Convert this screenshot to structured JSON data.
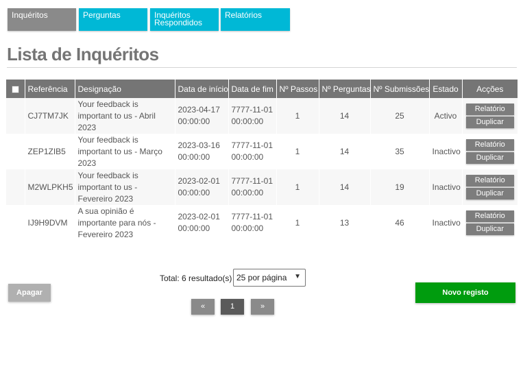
{
  "tabs": [
    {
      "label": "Inquéritos",
      "active": true
    },
    {
      "label": "Perguntas",
      "active": false
    },
    {
      "label": "Inquéritos Respondidos",
      "active": false
    },
    {
      "label": "Relatórios",
      "active": false
    }
  ],
  "page_title": "Lista de Inquéritos",
  "table": {
    "headers": [
      "Referência",
      "Designação",
      "Data de início",
      "Data de fim",
      "Nº Passos",
      "Nº Perguntas",
      "Nº Submissões",
      "Estado",
      "Acções"
    ],
    "rows": [
      {
        "ref": "CJ7TM7JK",
        "desig": "Your feedback is important to us - Abril 2023",
        "start": "2023-04-17 00:00:00",
        "end": "7777-11-01 00:00:00",
        "steps": "1",
        "questions": "14",
        "submissions": "25",
        "status": "Activo",
        "active": true
      },
      {
        "ref": "ZEP1ZIB5",
        "desig": "Your feedback is important to us - Março 2023",
        "start": "2023-03-16 00:00:00",
        "end": "7777-11-01 00:00:00",
        "steps": "1",
        "questions": "14",
        "submissions": "35",
        "status": "Inactivo",
        "active": false
      },
      {
        "ref": "M2WLPKH5",
        "desig": "Your feedback is important to us - Fevereiro 2023",
        "start": "2023-02-01 00:00:00",
        "end": "7777-11-01 00:00:00",
        "steps": "1",
        "questions": "14",
        "submissions": "19",
        "status": "Inactivo",
        "active": false
      },
      {
        "ref": "IJ9H9DVM",
        "desig": "A sua opinião é importante para nós - Fevereiro 2023",
        "start": "2023-02-01 00:00:00",
        "end": "7777-11-01 00:00:00",
        "steps": "1",
        "questions": "13",
        "submissions": "46",
        "status": "Inactivo",
        "active": false
      }
    ],
    "action_report": "Relatório",
    "action_duplicate": "Duplicar"
  },
  "footer": {
    "total_label": "Total: 6 resultado(s)",
    "per_page": "25 por página",
    "delete_label": "Apagar",
    "new_label": "Novo registo",
    "pager_prev": "«",
    "pager_current": "1",
    "pager_next": "»"
  },
  "colors": {
    "tab_active": "#8a8a8a",
    "tab_inactive": "#00b8d6",
    "status_active": "#1e8b1e",
    "status_inactive": "#e8201e",
    "new_button": "#009c0e"
  },
  "icons": {
    "per_page_caret": "chevron-down-icon"
  }
}
